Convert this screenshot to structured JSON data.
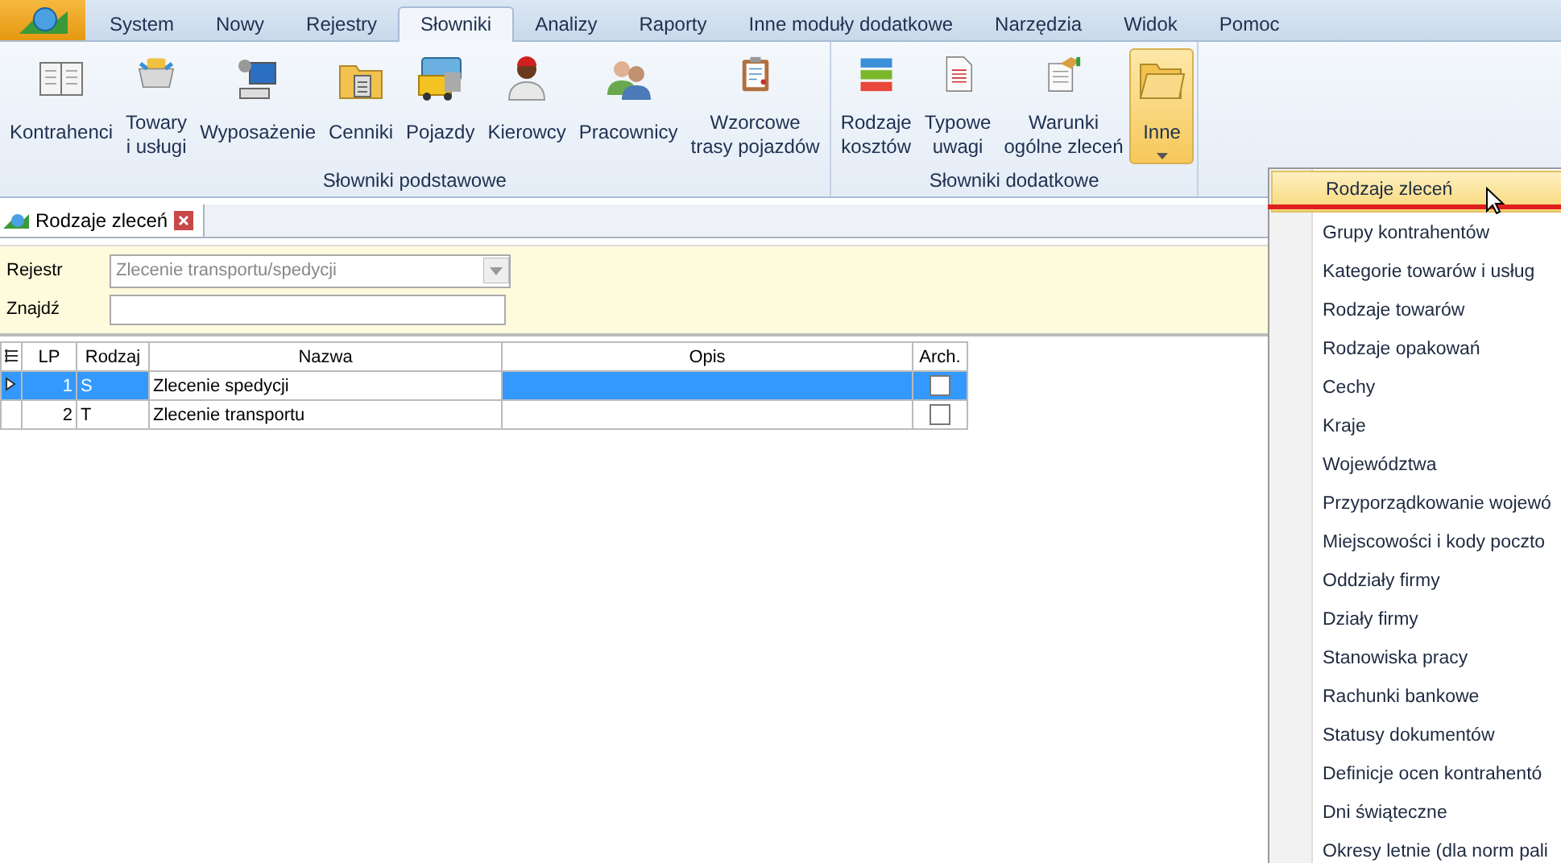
{
  "app_tabs": [
    {
      "label": "System",
      "selected": false
    },
    {
      "label": "Nowy",
      "selected": false
    },
    {
      "label": "Rejestry",
      "selected": false
    },
    {
      "label": "Słowniki",
      "selected": true
    },
    {
      "label": "Analizy",
      "selected": false
    },
    {
      "label": "Raporty",
      "selected": false
    },
    {
      "label": "Inne moduły dodatkowe",
      "selected": false
    },
    {
      "label": "Narzędzia",
      "selected": false
    },
    {
      "label": "Widok",
      "selected": false
    },
    {
      "label": "Pomoc",
      "selected": false
    }
  ],
  "ribbon": {
    "groups": [
      {
        "label": "Słowniki podstawowe",
        "buttons": [
          {
            "lines": [
              "Kontrahenci"
            ],
            "kind": "button",
            "selected": false
          },
          {
            "lines": [
              "Towary",
              "i usługi"
            ],
            "kind": "button",
            "selected": false
          },
          {
            "lines": [
              "Wyposażenie"
            ],
            "kind": "button",
            "selected": false
          },
          {
            "lines": [
              "Cenniki"
            ],
            "kind": "button",
            "selected": false
          },
          {
            "lines": [
              "Pojazdy"
            ],
            "kind": "button",
            "selected": false
          },
          {
            "lines": [
              "Kierowcy"
            ],
            "kind": "button",
            "selected": false
          },
          {
            "lines": [
              "Pracownicy"
            ],
            "kind": "button",
            "selected": false
          },
          {
            "lines": [
              "Wzorcowe",
              "trasy pojazdów"
            ],
            "kind": "button",
            "selected": false
          }
        ]
      },
      {
        "label": "Słowniki dodatkowe",
        "buttons": [
          {
            "lines": [
              "Rodzaje",
              "kosztów"
            ],
            "kind": "button",
            "selected": false
          },
          {
            "lines": [
              "Typowe",
              "uwagi"
            ],
            "kind": "button",
            "selected": false
          },
          {
            "lines": [
              "Warunki",
              "ogólne zleceń"
            ],
            "kind": "button",
            "selected": false
          },
          {
            "lines": [
              "Inne"
            ],
            "kind": "dropdown",
            "selected": true
          }
        ]
      }
    ]
  },
  "document_tab": {
    "title": "Rodzaje zleceń"
  },
  "filter": {
    "register_label": "Rejestr",
    "register_value": "Zlecenie transportu/spedycji",
    "register_disabled": true,
    "find_label": "Znajdź"
  },
  "table": {
    "columns": [
      "LP",
      "Rodzaj",
      "Nazwa",
      "Opis",
      "Arch."
    ],
    "rows": [
      {
        "lp": "1",
        "kind": "S",
        "name": "Zlecenie spedycji",
        "archived": false,
        "selected": true
      },
      {
        "lp": "2",
        "kind": "T",
        "name": "Zlecenie transportu",
        "archived": false,
        "selected": false
      }
    ]
  },
  "menu": {
    "items": [
      {
        "label": "Rodzaje zleceń",
        "selected": true
      },
      {
        "label": "Grupy kontrahentów",
        "selected": false
      },
      {
        "label": "Kategorie towarów i usług",
        "selected": false
      },
      {
        "label": "Rodzaje towarów",
        "selected": false
      },
      {
        "label": "Rodzaje opakowań",
        "selected": false
      },
      {
        "label": "Cechy",
        "selected": false
      },
      {
        "label": "Kraje",
        "selected": false
      },
      {
        "label": "Województwa",
        "selected": false
      },
      {
        "label": "Przyporządkowanie wojewó",
        "selected": false
      },
      {
        "label": "Miejscowości i kody poczto",
        "selected": false
      },
      {
        "label": "Oddziały firmy",
        "selected": false
      },
      {
        "label": "Działy firmy",
        "selected": false
      },
      {
        "label": "Stanowiska pracy",
        "selected": false
      },
      {
        "label": "Rachunki bankowe",
        "selected": false
      },
      {
        "label": "Statusy dokumentów",
        "selected": false
      },
      {
        "label": "Definicje ocen kontrahentó",
        "selected": false
      },
      {
        "label": "Dni świąteczne",
        "selected": false
      },
      {
        "label": "Okresy letnie (dla norm pali",
        "selected": false
      }
    ]
  }
}
